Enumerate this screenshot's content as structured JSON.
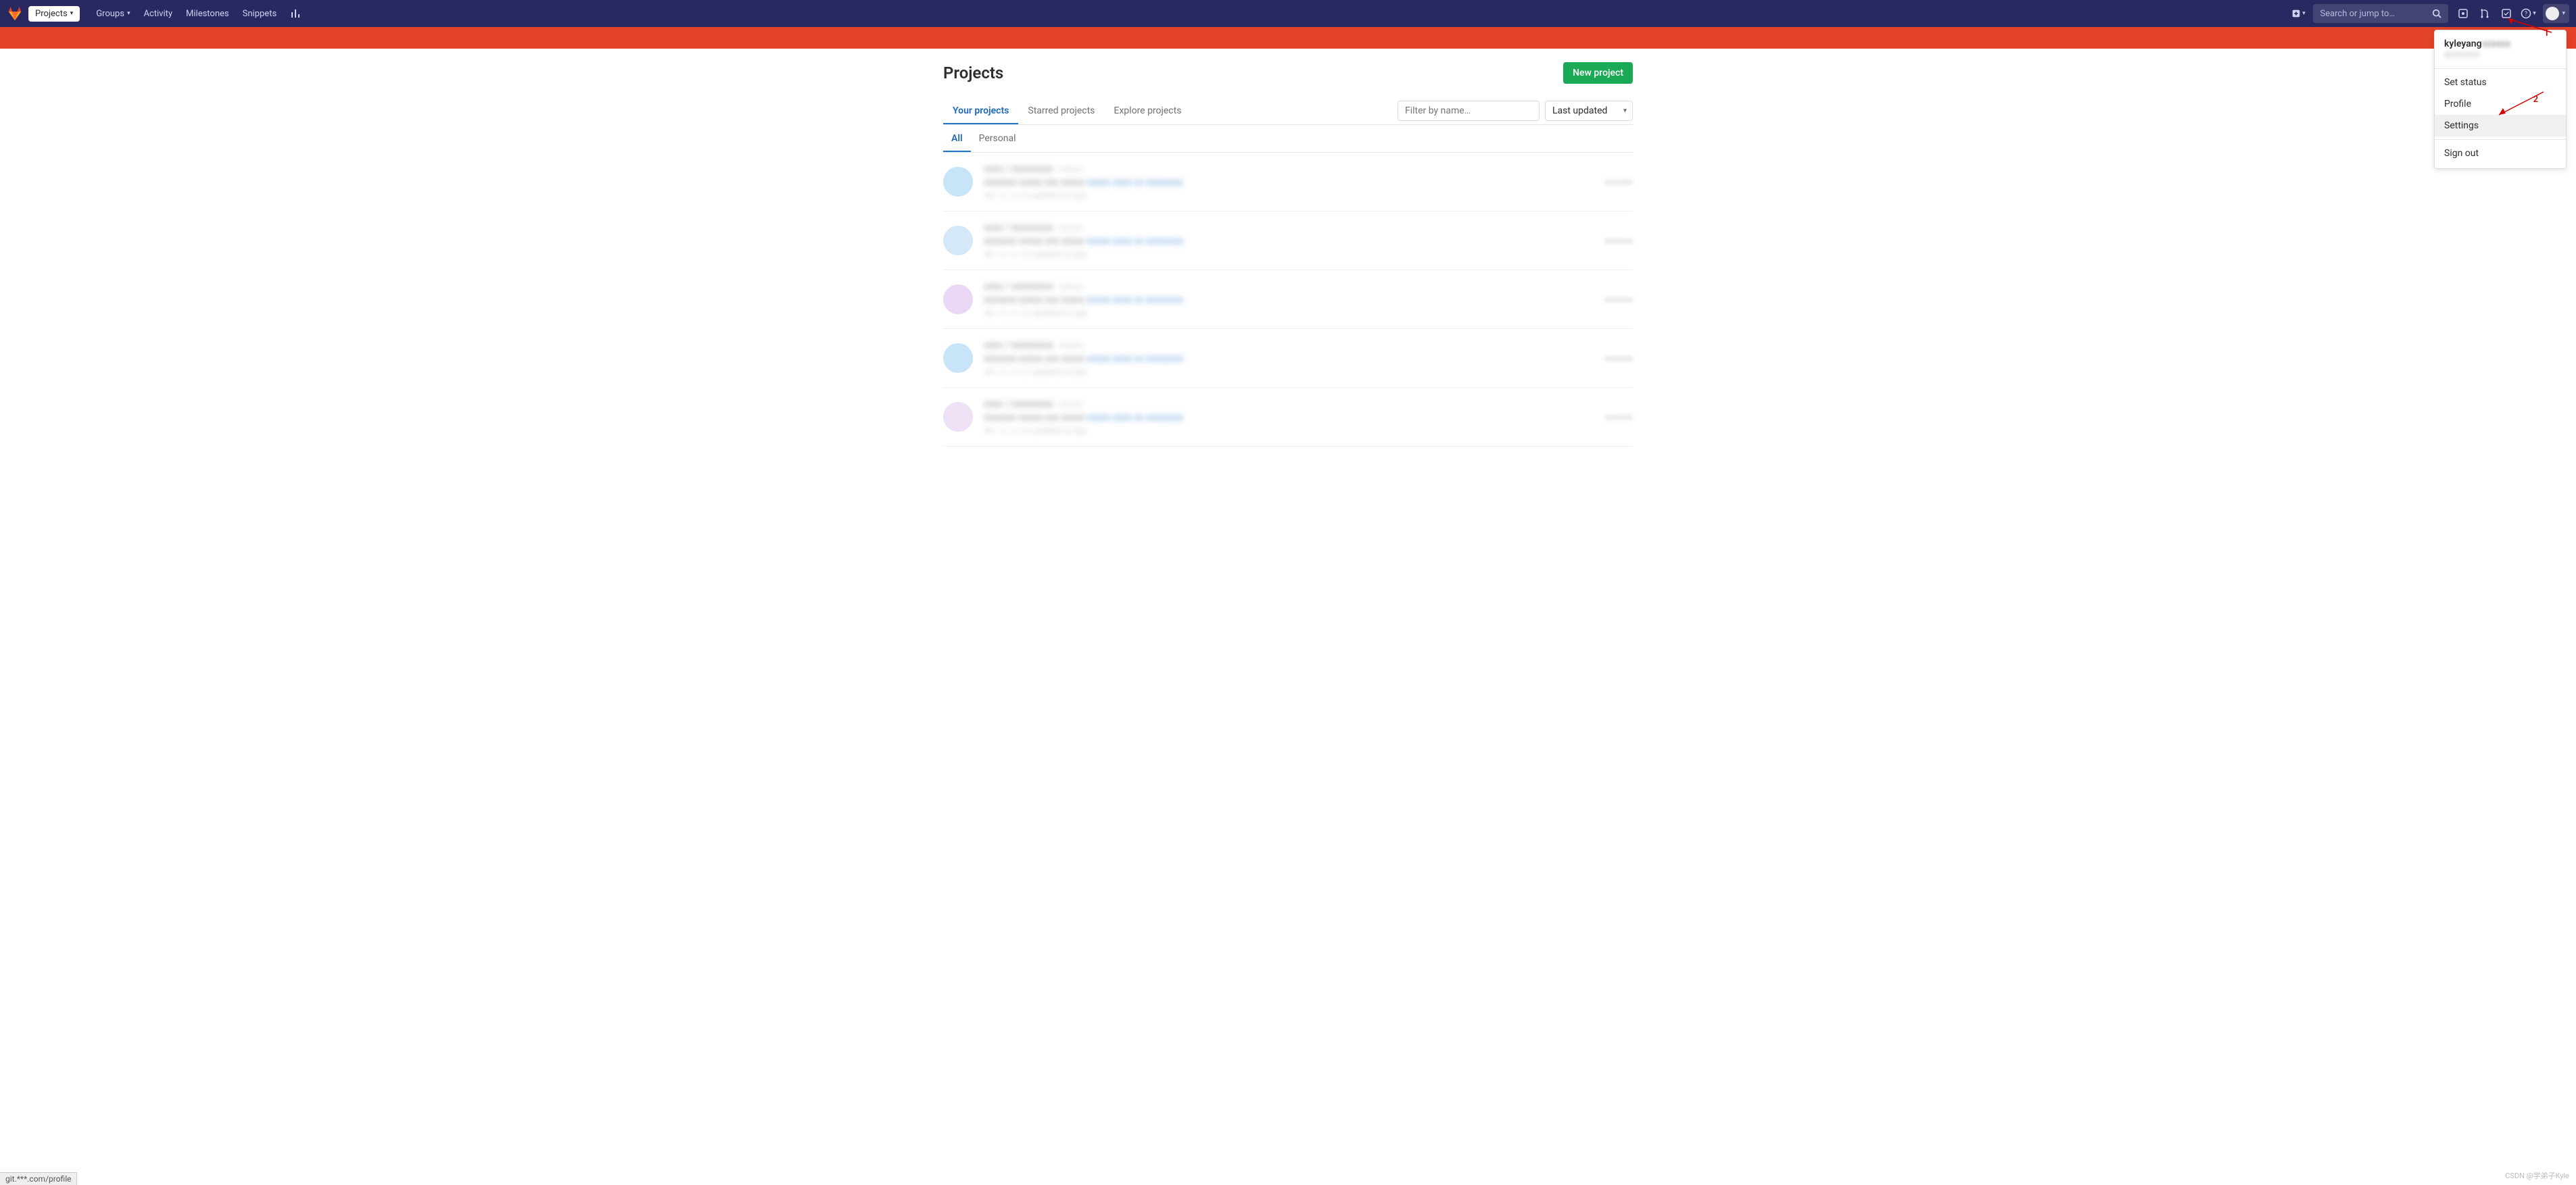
{
  "navbar": {
    "projects_btn": "Projects",
    "links": [
      "Groups",
      "Activity",
      "Milestones",
      "Snippets"
    ],
    "search_placeholder": "Search or jump to…"
  },
  "page": {
    "title": "Projects",
    "new_button": "New project"
  },
  "tabs": {
    "main": [
      "Your projects",
      "Starred projects",
      "Explore projects"
    ],
    "filter_placeholder": "Filter by name…",
    "sort_label": "Last updated"
  },
  "subtabs": [
    "All",
    "Personal"
  ],
  "user_menu": {
    "username": "kyleyang",
    "items": [
      "Set status",
      "Profile",
      "Settings"
    ],
    "signout": "Sign out"
  },
  "annotations": {
    "arrow1": "1",
    "arrow2": "2"
  },
  "status_url": "git.***.com/profile",
  "watermark": "CSDN @学弟子Kyle",
  "projects": [
    {
      "avatar_color": "pa-blue"
    },
    {
      "avatar_color": "pa-lblue"
    },
    {
      "avatar_color": "pa-purple"
    },
    {
      "avatar_color": "pa-blue"
    },
    {
      "avatar_color": "pa-lpurple"
    }
  ]
}
